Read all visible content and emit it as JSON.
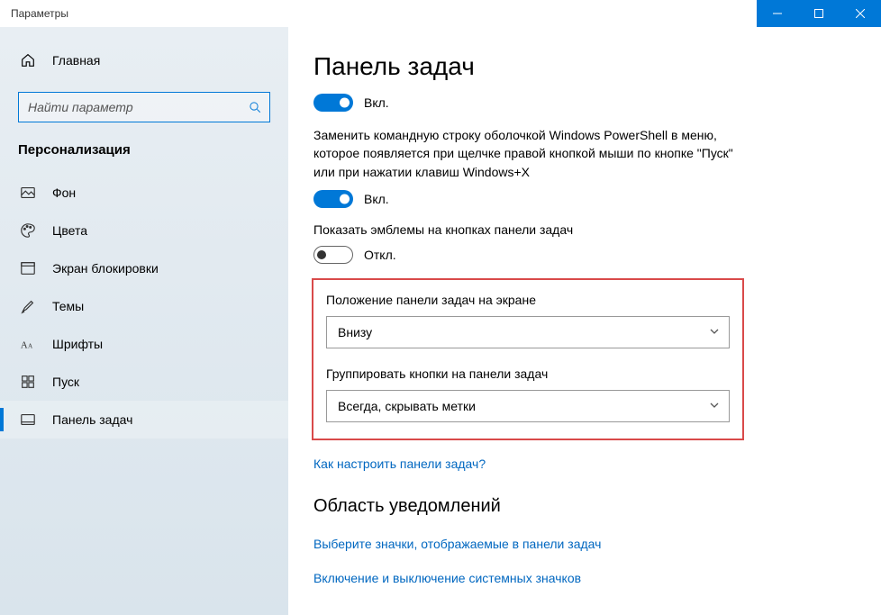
{
  "window": {
    "title": "Параметры"
  },
  "sidebar": {
    "home": "Главная",
    "search_placeholder": "Найти параметр",
    "category": "Персонализация",
    "items": [
      {
        "label": "Фон"
      },
      {
        "label": "Цвета"
      },
      {
        "label": "Экран блокировки"
      },
      {
        "label": "Темы"
      },
      {
        "label": "Шрифты"
      },
      {
        "label": "Пуск"
      },
      {
        "label": "Панель задач"
      }
    ]
  },
  "main": {
    "title": "Панель задач",
    "toggle1": {
      "state": "on",
      "label": "Вкл."
    },
    "powershell_desc": "Заменить командную строку оболочкой Windows PowerShell в меню, которое появляется при щелчке правой кнопкой мыши по кнопке \"Пуск\" или при нажатии клавиш Windows+X",
    "toggle2": {
      "state": "on",
      "label": "Вкл."
    },
    "badges_label": "Показать эмблемы на кнопках панели задач",
    "toggle3": {
      "state": "off",
      "label": "Откл."
    },
    "position_label": "Положение панели задач на экране",
    "position_value": "Внизу",
    "group_label": "Группировать кнопки на панели задач",
    "group_value": "Всегда, скрывать метки",
    "how_link": "Как настроить панели задач?",
    "notif_heading": "Область уведомлений",
    "select_icons_link": "Выберите значки, отображаемые в панели задач",
    "system_icons_link": "Включение и выключение системных значков"
  }
}
